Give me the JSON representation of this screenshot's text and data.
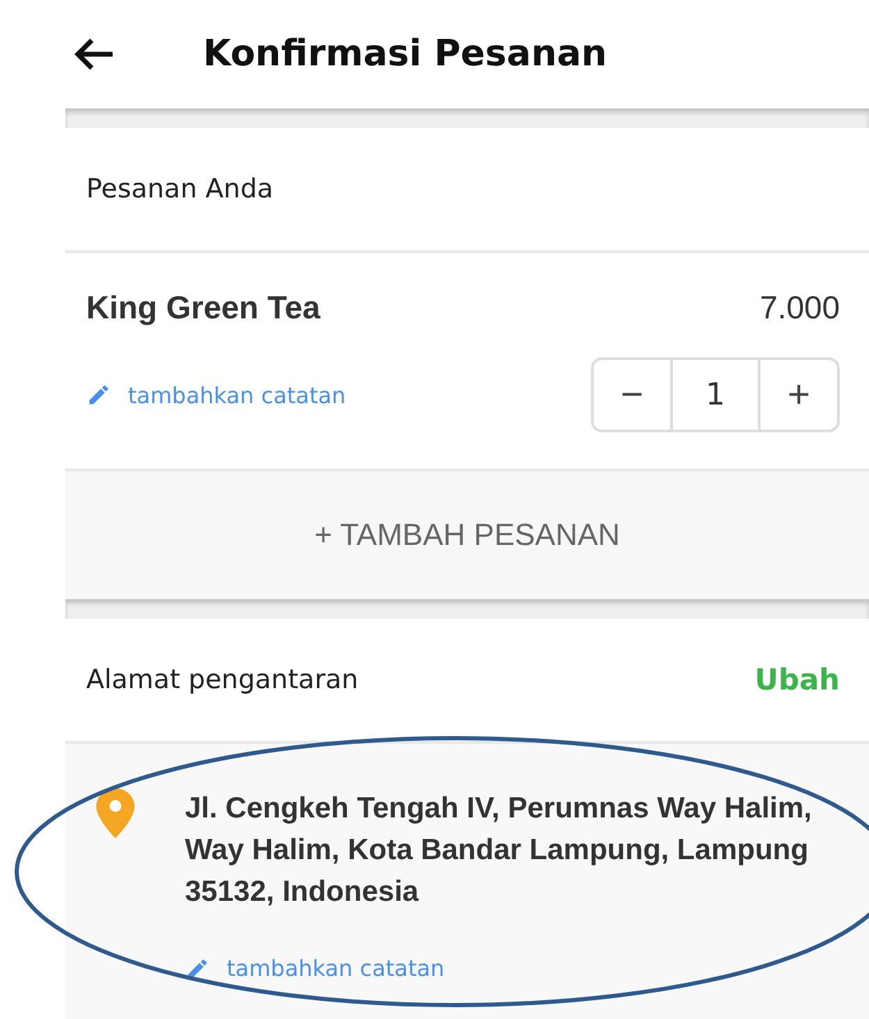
{
  "header": {
    "title": "Konfirmasi Pesanan"
  },
  "order": {
    "heading": "Pesanan Anda",
    "items": [
      {
        "name": "King Green Tea",
        "price": "7.000",
        "note_link": "tambahkan catatan",
        "quantity": "1",
        "minus": "−",
        "plus": "+"
      }
    ],
    "add_button": "+ TAMBAH PESANAN"
  },
  "address": {
    "heading": "Alamat pengantaran",
    "change_link": "Ubah",
    "text": "Jl. Cengkeh Tengah IV, Perumnas Way Halim, Way Halim, Kota Bandar Lampung, Lampung 35132, Indonesia",
    "note_link": "tambahkan catatan"
  }
}
